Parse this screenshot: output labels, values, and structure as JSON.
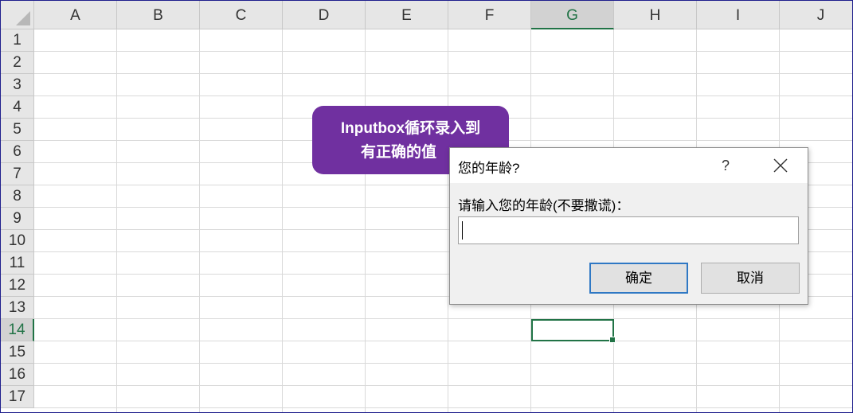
{
  "spreadsheet": {
    "columns": [
      "A",
      "B",
      "C",
      "D",
      "E",
      "F",
      "G",
      "H",
      "I",
      "J"
    ],
    "rows": [
      "1",
      "2",
      "3",
      "4",
      "5",
      "6",
      "7",
      "8",
      "9",
      "10",
      "11",
      "12",
      "13",
      "14",
      "15",
      "16",
      "17"
    ],
    "selected_column": "G",
    "selected_row": "14"
  },
  "callout": {
    "line1": "Inputbox循环录入到",
    "line2": "有正确的值",
    "color": "#7030a0"
  },
  "dialog": {
    "title": "您的年龄?",
    "help_label": "?",
    "close_icon": "close-icon",
    "prompt": "请输入您的年龄(不要撒谎)：",
    "input_value": "",
    "ok_label": "确定",
    "cancel_label": "取消"
  }
}
